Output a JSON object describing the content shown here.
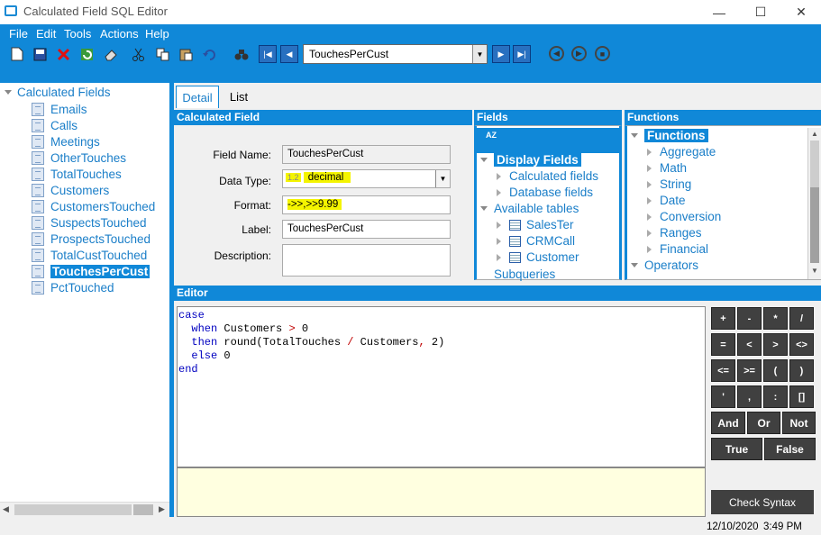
{
  "window": {
    "title": "Calculated Field SQL Editor",
    "minimize": "—",
    "maximize": "☐",
    "close": "✕"
  },
  "menu": [
    "File",
    "Edit",
    "Tools",
    "Actions",
    "Help"
  ],
  "toolbar": {
    "field_combo": "TouchesPerCust"
  },
  "tree": {
    "root": "Calculated Fields",
    "items": [
      "Emails",
      "Calls",
      "Meetings",
      "OtherTouches",
      "TotalTouches",
      "Customers",
      "CustomersTouched",
      "SuspectsTouched",
      "ProspectsTouched",
      "TotalCustTouched",
      "TouchesPerCust",
      "PctTouched"
    ],
    "selected": "TouchesPerCust"
  },
  "tabs": {
    "detail": "Detail",
    "list": "List"
  },
  "calc_field": {
    "header": "Calculated Field",
    "field_name_label": "Field Name:",
    "field_name_value": "TouchesPerCust",
    "data_type_label": "Data Type:",
    "data_type_prefix": "1.2",
    "data_type_value": "decimal",
    "format_label": "Format:",
    "format_value": "->>,>>9.99",
    "label_label": "Label:",
    "label_value": "TouchesPerCust",
    "description_label": "Description:"
  },
  "fields": {
    "header": "Fields",
    "sort_icon": "AZ",
    "display_fields": "Display Fields",
    "calculated_fields": "Calculated fields",
    "database_fields": "Database fields",
    "available_tables": "Available tables",
    "tables": [
      "SalesTer",
      "CRMCall",
      "Customer"
    ],
    "subqueries": "Subqueries"
  },
  "functions": {
    "header": "Functions",
    "group": "Functions",
    "items": [
      "Aggregate",
      "Math",
      "String",
      "Date",
      "Conversion",
      "Ranges",
      "Financial"
    ],
    "operators": "Operators"
  },
  "editor": {
    "header": "Editor"
  },
  "keypad": {
    "rows": [
      [
        "+",
        "-",
        "*",
        "/"
      ],
      [
        "=",
        "<",
        ">",
        "<>"
      ],
      [
        "<=",
        ">=",
        "(",
        ")"
      ],
      [
        "'",
        ",",
        ":",
        "[]"
      ]
    ],
    "logic": [
      "And",
      "Or",
      "Not"
    ],
    "bools": [
      "True",
      "False"
    ],
    "check_syntax": "Check Syntax"
  },
  "status": {
    "date": "12/10/2020",
    "time": "3:49 PM"
  },
  "colors": {
    "accent": "#1088d8",
    "highlight": "#f4f400",
    "keypad": "#404040"
  }
}
